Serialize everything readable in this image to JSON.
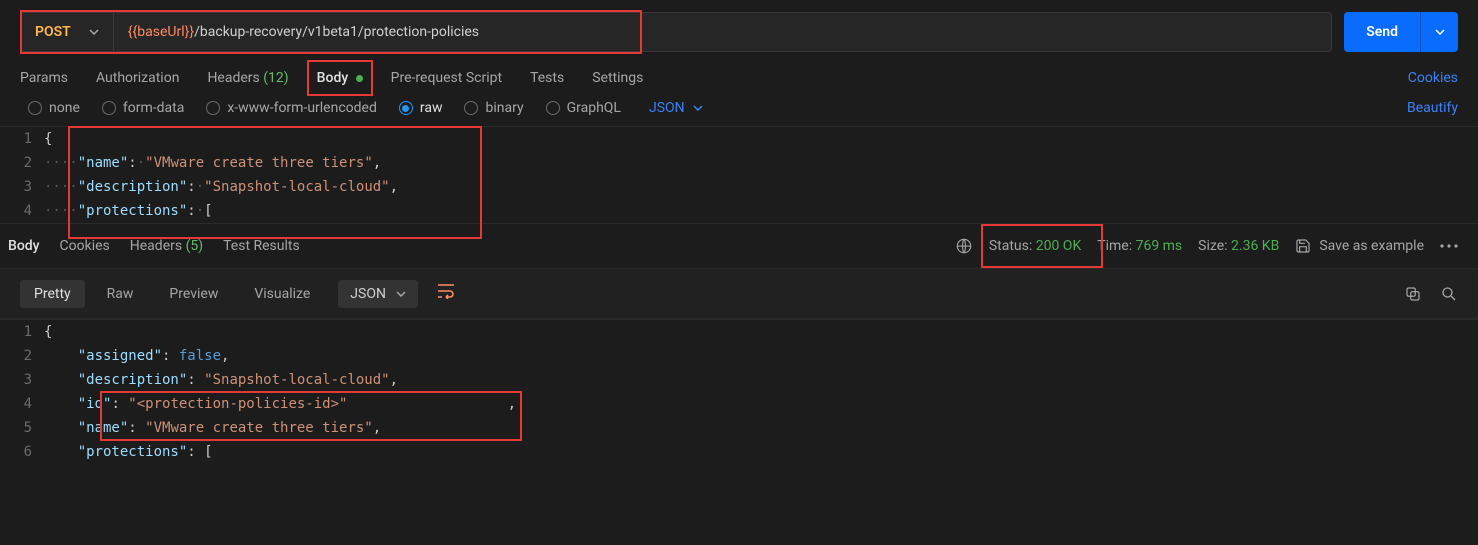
{
  "request": {
    "method": "POST",
    "url_prefix_var": "{{baseUrl}}",
    "url_path": "/backup-recovery/v1beta1/protection-policies",
    "send_label": "Send"
  },
  "tabs": {
    "params": "Params",
    "authorization": "Authorization",
    "headers_label": "Headers",
    "headers_count": "(12)",
    "body": "Body",
    "prerequest": "Pre-request Script",
    "tests": "Tests",
    "settings": "Settings",
    "cookies": "Cookies"
  },
  "body_types": {
    "none": "none",
    "form_data": "form-data",
    "urlencoded": "x-www-form-urlencoded",
    "raw": "raw",
    "binary": "binary",
    "graphql": "GraphQL",
    "format": "JSON",
    "beautify": "Beautify"
  },
  "request_body": {
    "l1": "{",
    "l2_key": "\"name\"",
    "l2_val": "\"VMware create three tiers\"",
    "l3_key": "\"description\"",
    "l3_val": "\"Snapshot-local-cloud\"",
    "l4_key": "\"protections\"",
    "l4_val": "["
  },
  "response": {
    "tabs": {
      "body": "Body",
      "cookies": "Cookies",
      "headers_label": "Headers",
      "headers_count": "(5)",
      "test_results": "Test Results"
    },
    "status_label": "Status:",
    "status_value": "200 OK",
    "time_label": "Time:",
    "time_value": "769 ms",
    "size_label": "Size:",
    "size_value": "2.36 KB",
    "save_example": "Save as example",
    "view": {
      "pretty": "Pretty",
      "raw": "Raw",
      "preview": "Preview",
      "visualize": "Visualize",
      "format": "JSON"
    },
    "body": {
      "l1": "{",
      "l2_key": "\"assigned\"",
      "l2_val": "false",
      "l3_key": "\"description\"",
      "l3_val": "\"Snapshot-local-cloud\"",
      "l4_key": "\"id\"",
      "l4_val": "\"<protection-policies-id>\"",
      "l5_key": "\"name\"",
      "l5_val": "\"VMware create three tiers\"",
      "l6_key": "\"protections\"",
      "l6_val": "["
    }
  }
}
